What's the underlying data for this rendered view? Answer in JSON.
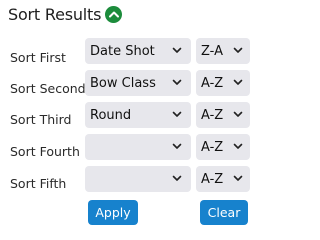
{
  "header": {
    "title": "Sort Results"
  },
  "rows": [
    {
      "label": "Sort First",
      "field": "Date Shot",
      "order": "Z-A"
    },
    {
      "label": "Sort Second",
      "field": "Bow Class",
      "order": "A-Z"
    },
    {
      "label": "Sort Third",
      "field": "Round",
      "order": "A-Z"
    },
    {
      "label": "Sort Fourth",
      "field": "",
      "order": "A-Z"
    },
    {
      "label": "Sort Fifth",
      "field": "",
      "order": "A-Z"
    }
  ],
  "buttons": {
    "apply": "Apply",
    "clear": "Clear"
  },
  "icons": {
    "collapse": "chevron-up-icon",
    "dropdown": "chevron-down-icon"
  },
  "colors": {
    "accent": "#1782cd",
    "collapse": "#1c8c3c",
    "select_bg": "#e7e7ec"
  }
}
